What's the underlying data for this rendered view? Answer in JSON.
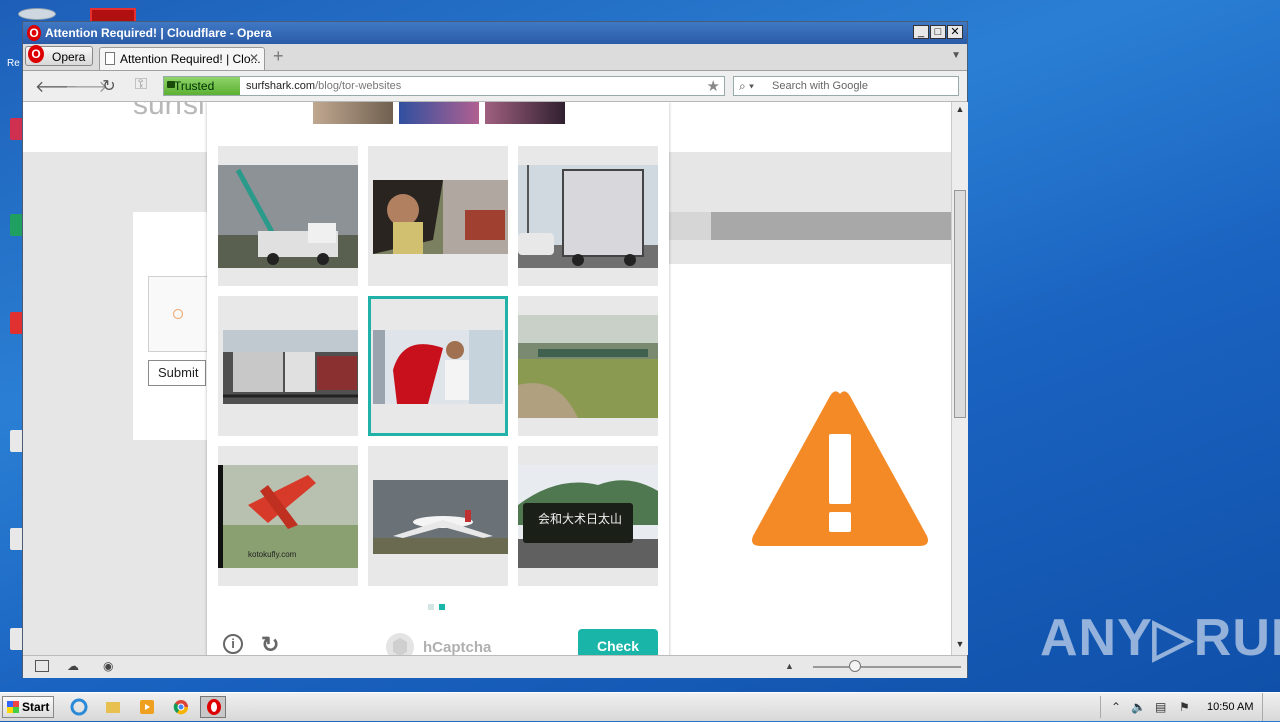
{
  "window": {
    "title": "Attention Required! | Cloudflare - Opera",
    "buttons": {
      "minimize": "_",
      "maximize": "□",
      "close": "✕"
    }
  },
  "tabbar": {
    "opera_menu_label": "Opera",
    "tab_title": "Attention Required! | Clo...",
    "tab_close": "✕",
    "new_tab": "+",
    "tab_menu": "▼"
  },
  "navbar": {
    "back": "🡐",
    "forward": "🡒",
    "reload": "↻",
    "key": "⚿",
    "trusted_label": "Trusted",
    "url_host": "surfshark.com",
    "url_path": "/blog/tor-websites",
    "bookmark_star": "★",
    "search_placeholder": "Search with Google"
  },
  "page": {
    "logo_fragment": "surfsl",
    "submit_label": "Submit"
  },
  "hcaptcha": {
    "grid": [
      {
        "name": "crane-truck-image",
        "selected": false
      },
      {
        "name": "person-with-umbrella-image",
        "selected": false
      },
      {
        "name": "box-truck-image",
        "selected": false
      },
      {
        "name": "freight-train-image",
        "selected": false
      },
      {
        "name": "red-umbrella-image",
        "selected": true
      },
      {
        "name": "train-field-image",
        "selected": false
      },
      {
        "name": "red-airplane-image",
        "selected": false
      },
      {
        "name": "airliner-image",
        "selected": false
      },
      {
        "name": "campaign-truck-image",
        "selected": false
      }
    ],
    "truck_sign_text": "会和大术日太山",
    "plane_caption": "kotokufly.com",
    "pagination": {
      "pages": 2,
      "current": 2
    },
    "info_icon": "i",
    "refresh_icon": "↻",
    "brand_label": "hCaptcha",
    "check_label": "Check"
  },
  "taskbar": {
    "start_label": "Start",
    "clock": "10:50 AM",
    "tray_up": "⌃"
  },
  "watermark": "ANY▷RUN",
  "colors": {
    "accent_teal": "#19b5a8",
    "warning_orange": "#f48a26",
    "trusted_green": "#5cb032"
  }
}
